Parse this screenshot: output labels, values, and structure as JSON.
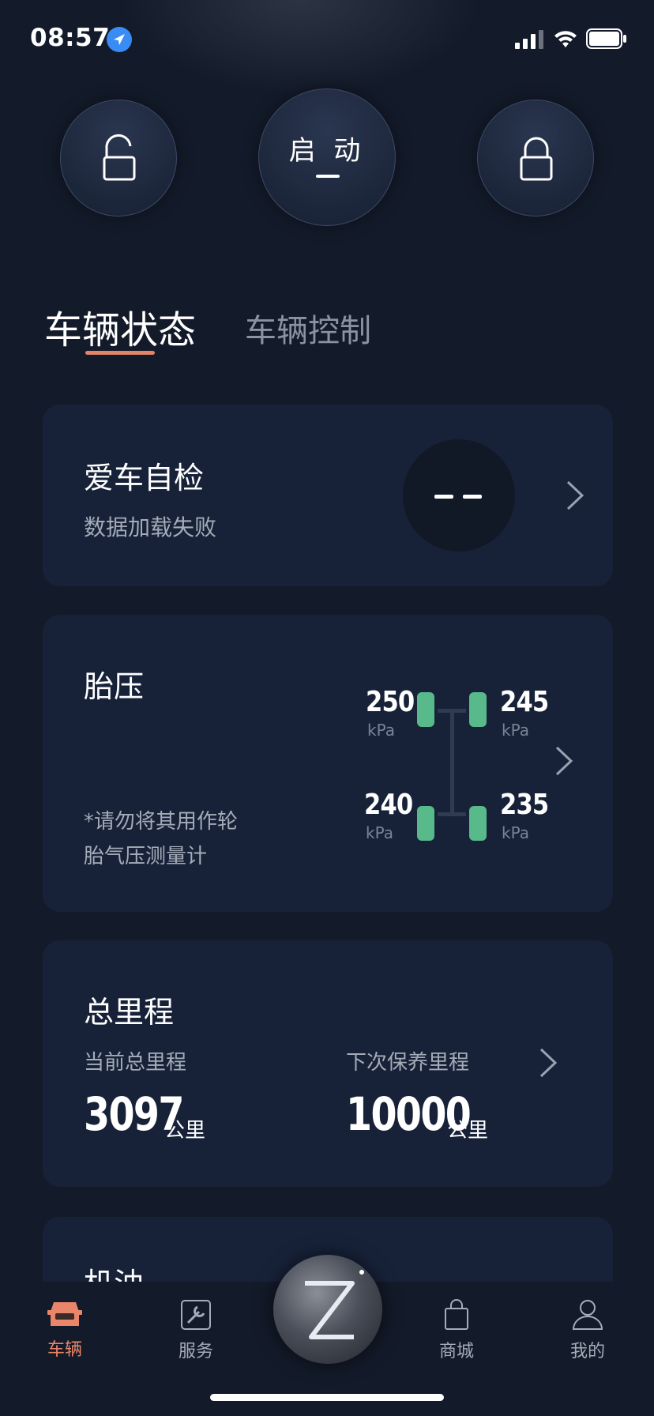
{
  "status_bar": {
    "time": "08:57",
    "icons": [
      "location-arrow-icon",
      "signal-icon",
      "wifi-icon",
      "battery-icon"
    ]
  },
  "top_controls": {
    "unlock_icon": "unlock-icon",
    "start_label": "启 动",
    "start_value": "—",
    "lock_icon": "lock-icon"
  },
  "tabs": [
    {
      "label": "车辆状态",
      "active": true
    },
    {
      "label": "车辆控制",
      "active": false
    }
  ],
  "self_check": {
    "title": "爱车自检",
    "subtitle": "数据加载失败",
    "score": "– –"
  },
  "tire_pressure": {
    "title": "胎压",
    "note": "*请勿将其用作轮胎气压测量计",
    "front_left": {
      "value": "250",
      "unit": "kPa"
    },
    "front_right": {
      "value": "245",
      "unit": "kPa"
    },
    "rear_left": {
      "value": "240",
      "unit": "kPa"
    },
    "rear_right": {
      "value": "235",
      "unit": "kPa"
    },
    "wheel_color": "#58b98a"
  },
  "mileage": {
    "title": "总里程",
    "current_label": "当前总里程",
    "current_value": "3097",
    "current_unit": "公里",
    "next_label": "下次保养里程",
    "next_value": "10000",
    "next_unit": "公里"
  },
  "oil": {
    "title": "机油"
  },
  "tabbar": {
    "items": [
      {
        "label": "车辆",
        "icon": "car-icon",
        "active": true
      },
      {
        "label": "服务",
        "icon": "wrench-icon",
        "active": false
      },
      {
        "label": "",
        "icon": "z-logo-icon",
        "active": false
      },
      {
        "label": "商城",
        "icon": "shopping-bag-icon",
        "active": false
      },
      {
        "label": "我的",
        "icon": "profile-icon",
        "active": false
      }
    ]
  },
  "colors": {
    "background": "#131a29",
    "card": "#172239",
    "accent": "#e0846a"
  }
}
